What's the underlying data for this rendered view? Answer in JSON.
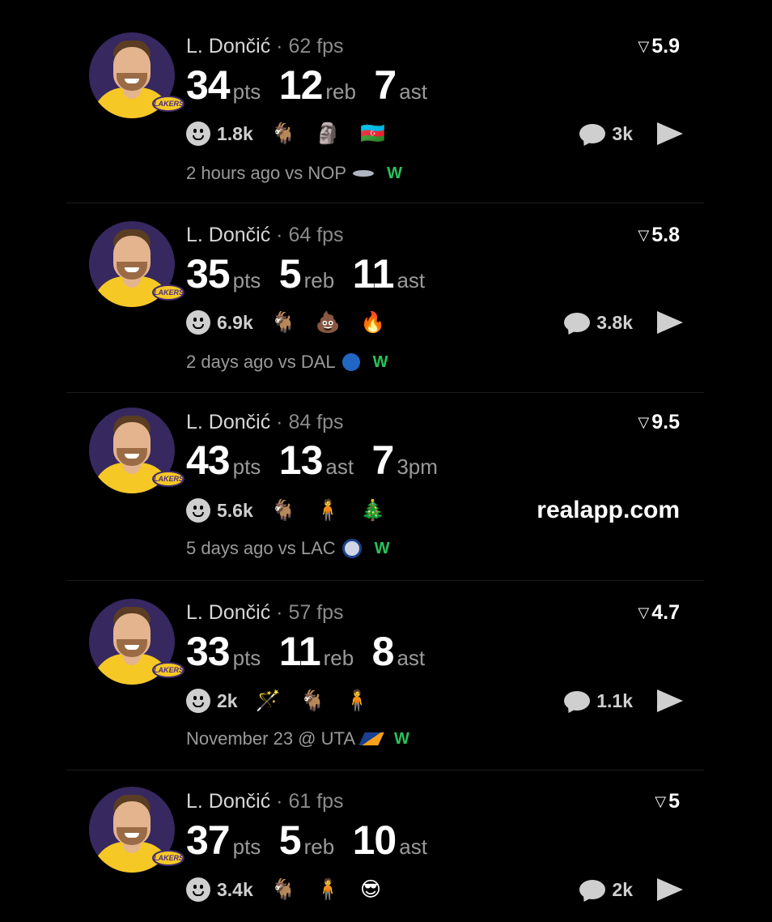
{
  "feed": {
    "posts": [
      {
        "player": "L. Dončić",
        "fps": "62 fps",
        "rating": "5.9",
        "stats": [
          {
            "value": "34",
            "label": "pts"
          },
          {
            "value": "12",
            "label": "reb"
          },
          {
            "value": "7",
            "label": "ast"
          }
        ],
        "reaction_count": "1.8k",
        "reactions": [
          "🐐",
          "🗿",
          "🇦🇿"
        ],
        "comments": "3k",
        "time": "2 hours ago vs NOP",
        "opponent_icon": "pelicans-logo",
        "result": "W"
      },
      {
        "player": "L. Dončić",
        "fps": "64 fps",
        "rating": "5.8",
        "stats": [
          {
            "value": "35",
            "label": "pts"
          },
          {
            "value": "5",
            "label": "reb"
          },
          {
            "value": "11",
            "label": "ast"
          }
        ],
        "reaction_count": "6.9k",
        "reactions": [
          "🐐",
          "💩",
          "🔥"
        ],
        "comments": "3.8k",
        "time": "2 days ago vs DAL",
        "opponent_icon": "mavericks-logo",
        "result": "W"
      },
      {
        "player": "L. Dončić",
        "fps": "84 fps",
        "rating": "9.5",
        "stats": [
          {
            "value": "43",
            "label": "pts"
          },
          {
            "value": "13",
            "label": "ast"
          },
          {
            "value": "7",
            "label": "3pm"
          }
        ],
        "reaction_count": "5.6k",
        "reactions": [
          "🐐",
          "🧍",
          "🎄"
        ],
        "promo": "realapp.com",
        "time": "5 days ago vs LAC",
        "opponent_icon": "clippers-logo",
        "result": "W"
      },
      {
        "player": "L. Dončić",
        "fps": "57 fps",
        "rating": "4.7",
        "stats": [
          {
            "value": "33",
            "label": "pts"
          },
          {
            "value": "11",
            "label": "reb"
          },
          {
            "value": "8",
            "label": "ast"
          }
        ],
        "reaction_count": "2k",
        "reactions": [
          "🪄",
          "🐐",
          "🧍"
        ],
        "comments": "1.1k",
        "time": "November 23 @ UTA",
        "opponent_icon": "jazz-logo",
        "result": "W"
      },
      {
        "player": "L. Dončić",
        "fps": "61 fps",
        "rating": "5",
        "stats": [
          {
            "value": "37",
            "label": "pts"
          },
          {
            "value": "5",
            "label": "reb"
          },
          {
            "value": "10",
            "label": "ast"
          }
        ],
        "reaction_count": "3.4k",
        "reactions": [
          "🐐",
          "🧍",
          "😎"
        ],
        "comments": "2k"
      }
    ],
    "separator": " · ",
    "avatar_badge": "LAKERS"
  }
}
